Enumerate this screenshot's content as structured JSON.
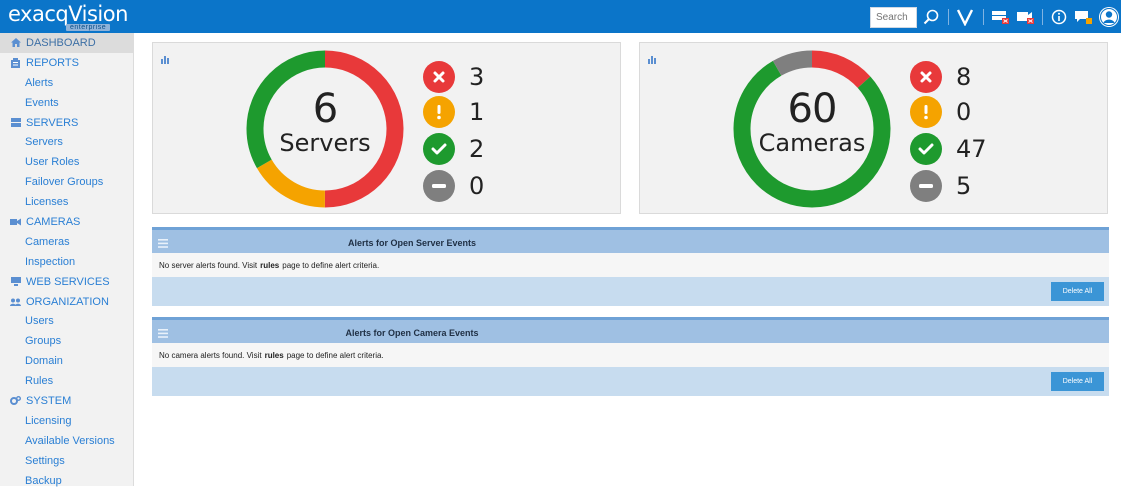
{
  "app": {
    "logo_text": "exacqVision",
    "logo_sub": "enterprise"
  },
  "topbar": {
    "search_placeholder": "Search",
    "icons": [
      "search-icon",
      "vision-icon",
      "server-alert-icon",
      "camera-alert-icon",
      "info-icon",
      "chat-icon",
      "user-avatar-icon"
    ]
  },
  "sidebar": {
    "items": [
      {
        "label": "DASHBOARD",
        "type": "section",
        "icon": "home-icon",
        "active": true
      },
      {
        "label": "REPORTS",
        "type": "section",
        "icon": "reports-icon"
      },
      {
        "label": "Alerts",
        "type": "link"
      },
      {
        "label": "Events",
        "type": "link"
      },
      {
        "label": "SERVERS",
        "type": "section",
        "icon": "servers-icon"
      },
      {
        "label": "Servers",
        "type": "link"
      },
      {
        "label": "User Roles",
        "type": "link"
      },
      {
        "label": "Failover Groups",
        "type": "link"
      },
      {
        "label": "Licenses",
        "type": "link"
      },
      {
        "label": "CAMERAS",
        "type": "section",
        "icon": "camera-icon"
      },
      {
        "label": "Cameras",
        "type": "link"
      },
      {
        "label": "Inspection",
        "type": "link"
      },
      {
        "label": "WEB SERVICES",
        "type": "section",
        "icon": "web-services-icon"
      },
      {
        "label": "ORGANIZATION",
        "type": "section",
        "icon": "organization-icon"
      },
      {
        "label": "Users",
        "type": "link"
      },
      {
        "label": "Groups",
        "type": "link"
      },
      {
        "label": "Domain",
        "type": "link"
      },
      {
        "label": "Rules",
        "type": "link"
      },
      {
        "label": "SYSTEM",
        "type": "section",
        "icon": "gears-icon"
      },
      {
        "label": "Licensing",
        "type": "link"
      },
      {
        "label": "Available Versions",
        "type": "link"
      },
      {
        "label": "Settings",
        "type": "link"
      },
      {
        "label": "Backup",
        "type": "link"
      }
    ]
  },
  "servers_panel": {
    "total": "6",
    "label": "Servers",
    "stats": {
      "error": "3",
      "warning": "1",
      "ok": "2",
      "disabled": "0"
    }
  },
  "cameras_panel": {
    "total": "60",
    "label": "Cameras",
    "stats": {
      "error": "8",
      "warning": "0",
      "ok": "47",
      "disabled": "5"
    }
  },
  "server_alerts": {
    "title": "Alerts for Open Server Events",
    "msg_before": "No server alerts found. Visit",
    "msg_link": "rules",
    "msg_after": "page to define alert criteria.",
    "delete_label": "Delete All"
  },
  "camera_alerts": {
    "title": "Alerts for Open Camera Events",
    "msg_before": "No camera alerts found. Visit",
    "msg_link": "rules",
    "msg_after": "page to define alert criteria.",
    "delete_label": "Delete All"
  },
  "colors": {
    "topbar": "#0b75c9",
    "error": "#e8393a",
    "warning": "#f5a300",
    "ok": "#1e9a2e",
    "disabled": "#7f7f7f",
    "link": "#2a7fd4"
  }
}
